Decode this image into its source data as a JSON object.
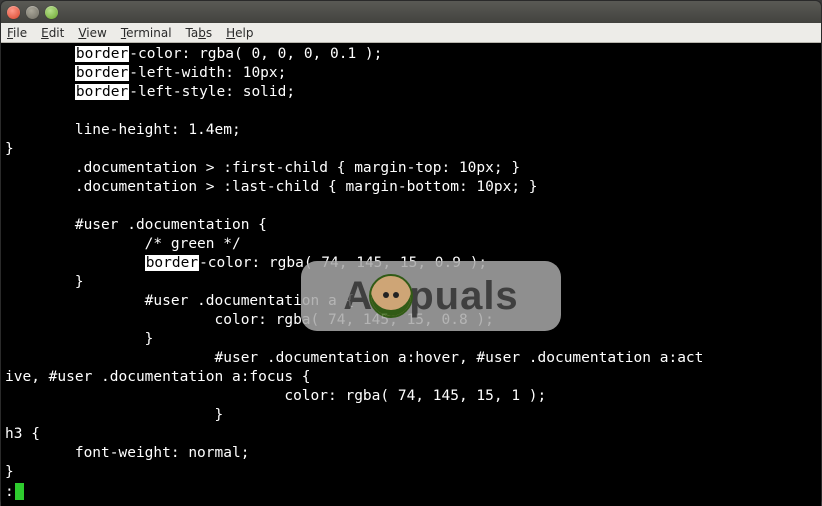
{
  "menubar": {
    "items": [
      {
        "k": "F",
        "rest": "ile"
      },
      {
        "k": "E",
        "rest": "dit"
      },
      {
        "k": "V",
        "rest": "iew"
      },
      {
        "k": "T",
        "rest": "erminal"
      },
      {
        "k": "",
        "rest": "Ta",
        "k2": "b",
        "rest2": "s"
      },
      {
        "k": "H",
        "rest": "elp"
      }
    ]
  },
  "terminal": {
    "highlight_word": "border",
    "lines": [
      {
        "indent": "        ",
        "parts": [
          {
            "hl": true,
            "t": "border"
          },
          {
            "t": "-color: rgba( 0, 0, 0, 0.1 );"
          }
        ]
      },
      {
        "indent": "        ",
        "parts": [
          {
            "hl": true,
            "t": "border"
          },
          {
            "t": "-left-width: 10px;"
          }
        ]
      },
      {
        "indent": "        ",
        "parts": [
          {
            "hl": true,
            "t": "border"
          },
          {
            "t": "-left-style: solid;"
          }
        ]
      },
      {
        "indent": "",
        "parts": [
          {
            "t": ""
          }
        ]
      },
      {
        "indent": "        ",
        "parts": [
          {
            "t": "line-height: 1.4em;"
          }
        ]
      },
      {
        "indent": "",
        "parts": [
          {
            "t": "}"
          }
        ]
      },
      {
        "indent": "        ",
        "parts": [
          {
            "t": ".documentation > :first-child { margin-top: 10px; }"
          }
        ]
      },
      {
        "indent": "        ",
        "parts": [
          {
            "t": ".documentation > :last-child { margin-bottom: 10px; }"
          }
        ]
      },
      {
        "indent": "",
        "parts": [
          {
            "t": ""
          }
        ]
      },
      {
        "indent": "        ",
        "parts": [
          {
            "t": "#user .documentation {"
          }
        ]
      },
      {
        "indent": "                ",
        "parts": [
          {
            "t": "/* green */"
          }
        ]
      },
      {
        "indent": "                ",
        "parts": [
          {
            "hl": true,
            "t": "border"
          },
          {
            "t": "-color: rgba( 74, 145, 15, 0.9 );"
          }
        ]
      },
      {
        "indent": "        ",
        "parts": [
          {
            "t": "}"
          }
        ]
      },
      {
        "indent": "                ",
        "parts": [
          {
            "t": "#user .documentation a {"
          }
        ]
      },
      {
        "indent": "                        ",
        "parts": [
          {
            "t": "color: rgba( 74, 145, 15, 0.8 );"
          }
        ]
      },
      {
        "indent": "                ",
        "parts": [
          {
            "t": "}"
          }
        ]
      },
      {
        "indent": "                        ",
        "parts": [
          {
            "t": "#user .documentation a:hover, #user .documentation a:act"
          }
        ]
      },
      {
        "indent": "",
        "parts": [
          {
            "t": "ive, #user .documentation a:focus {"
          }
        ]
      },
      {
        "indent": "                                ",
        "parts": [
          {
            "t": "color: rgba( 74, 145, 15, 1 );"
          }
        ]
      },
      {
        "indent": "                        ",
        "parts": [
          {
            "t": "}"
          }
        ]
      },
      {
        "indent": "",
        "parts": [
          {
            "t": "h3 {"
          }
        ]
      },
      {
        "indent": "        ",
        "parts": [
          {
            "t": "font-weight: normal;"
          }
        ]
      },
      {
        "indent": "",
        "parts": [
          {
            "t": "}"
          }
        ]
      }
    ],
    "status": ":"
  },
  "watermark": {
    "left": "A",
    "right": "puals"
  }
}
